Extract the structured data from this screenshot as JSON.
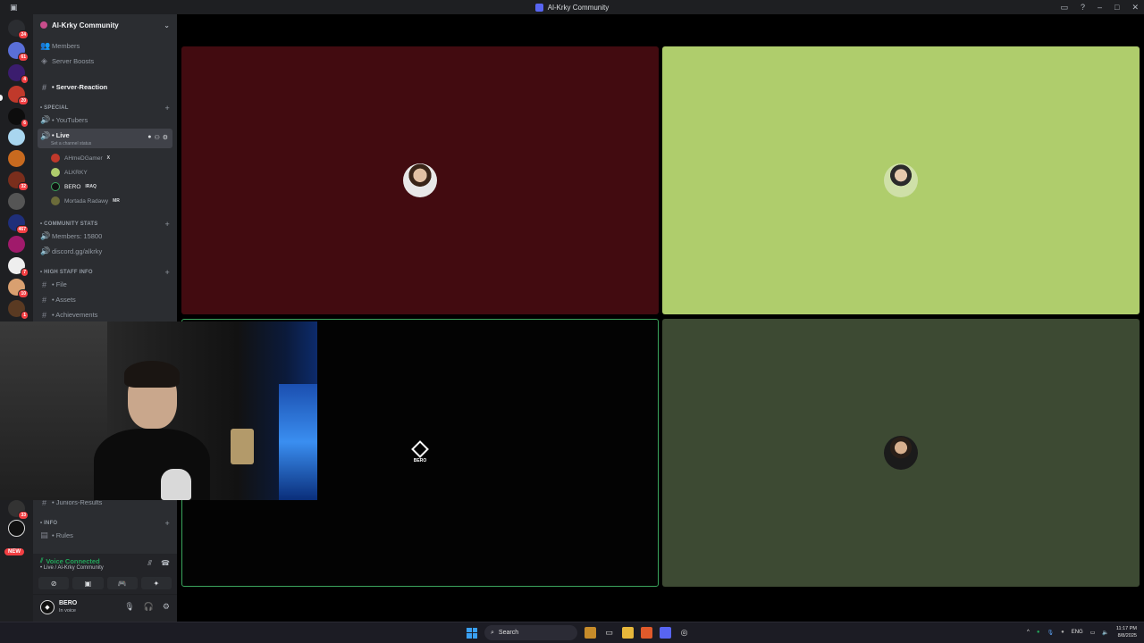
{
  "window": {
    "title": "Al-Krky Community"
  },
  "server": {
    "name": "Al-Krky Community"
  },
  "rail": {
    "badges": [
      "24",
      "61",
      "4",
      "20",
      "6",
      "32",
      "467",
      "7",
      "10",
      "1",
      "33"
    ],
    "new_label": "NEW"
  },
  "sidebar": {
    "top_items": [
      {
        "label": "Members",
        "icon": "members-icon"
      },
      {
        "label": "Server Boosts",
        "icon": "boost-icon"
      }
    ],
    "server_reaction": "• Server-Reaction",
    "categories": {
      "special": "• SPECIAL",
      "community_stats": "• COMMUNITY STATS",
      "high_staff_info": "• HIGH STAFF INFO",
      "info": "• INFO"
    },
    "youtubers": "• YouTubers",
    "live": {
      "label": "• Live",
      "status": "Set a channel status"
    },
    "voice_users": [
      {
        "name": "AHmeDGamer",
        "tag": "X",
        "color": "#c0392b"
      },
      {
        "name": "ALKRKY",
        "tag": "",
        "color": "#afcd6c"
      },
      {
        "name": "BERO",
        "tag": "IRAQ",
        "color": "#111111"
      },
      {
        "name": "Mortada Radawy",
        "tag": "MR",
        "color": "#6b6b3a"
      }
    ],
    "members_count": "Members: 15800",
    "invite": "discord.gg/alkrky",
    "file": "• File",
    "assets": "• Assets",
    "achievements": "• Achievements",
    "juniors_results": "• Juniors-Results",
    "rules": "• Rules"
  },
  "voice_panel": {
    "status": "Voice Connected",
    "location": "• Live / Al-Krky Community"
  },
  "user_panel": {
    "name": "BERO",
    "status": "In voice"
  },
  "stage": {
    "tiles": [
      {
        "id": "ahmedgamer",
        "bg": "#420b10"
      },
      {
        "id": "alkrky",
        "bg": "#afcd6c"
      },
      {
        "id": "bero",
        "bg": "#030303",
        "label": "BERO",
        "speaking": true
      },
      {
        "id": "mortada",
        "bg": "#3d4a33"
      }
    ]
  },
  "taskbar": {
    "search_placeholder": "Search",
    "lang": "ENG",
    "time": "11:17 PM",
    "date": "8/8/2025"
  }
}
